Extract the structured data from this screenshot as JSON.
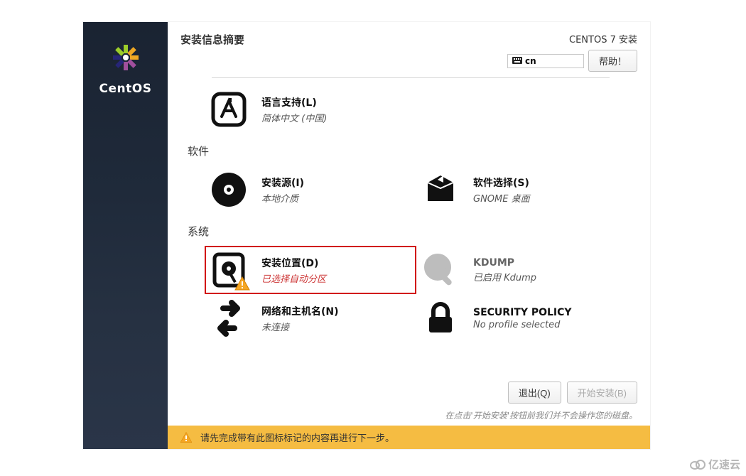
{
  "brand": {
    "name": "CentOS"
  },
  "header": {
    "title": "安装信息摘要",
    "product": "CENTOS 7 安装",
    "keyboard_layout": "cn",
    "help_label": "帮助！"
  },
  "spokes": {
    "language": {
      "title": "语言支持(L)",
      "status": "简体中文 (中国)"
    },
    "cat_software": "软件",
    "source": {
      "title": "安装源(I)",
      "status": "本地介质"
    },
    "softsel": {
      "title": "软件选择(S)",
      "status": "GNOME 桌面"
    },
    "cat_system": "系统",
    "dest": {
      "title": "安装位置(D)",
      "status": "已选择自动分区"
    },
    "kdump": {
      "title": "KDUMP",
      "status": "已启用 Kdump"
    },
    "network": {
      "title": "网络和主机名(N)",
      "status": "未连接"
    },
    "secpol": {
      "title": "SECURITY POLICY",
      "status": "No profile selected"
    }
  },
  "footer": {
    "quit_label": "退出(Q)",
    "begin_label": "开始安装(B)",
    "note": "在点击'开始安装'按钮前我们并不会操作您的磁盘。"
  },
  "warnbar": {
    "text": "请先完成带有此图标标记的内容再进行下一步。"
  },
  "watermark": "亿速云"
}
